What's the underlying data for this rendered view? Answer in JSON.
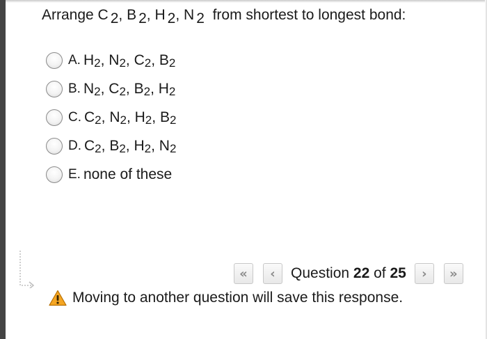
{
  "question": {
    "prefix": "Arrange ",
    "molecules": [
      {
        "el": "C",
        "sub": "2",
        "sep": ","
      },
      {
        "el": "B",
        "sub": "2",
        "sep": ","
      },
      {
        "el": "H",
        "sub": "2",
        "sep": ","
      },
      {
        "el": "N",
        "sub": "2",
        "sep": ""
      }
    ],
    "suffix": "from shortest to longest bond:"
  },
  "options": [
    {
      "letter": "A.",
      "molecules": [
        [
          "H",
          "2"
        ],
        [
          "N",
          "2"
        ],
        [
          "C",
          "2"
        ],
        [
          "B",
          "2"
        ]
      ]
    },
    {
      "letter": "B.",
      "molecules": [
        [
          "N",
          "2"
        ],
        [
          "C",
          "2"
        ],
        [
          "B",
          "2"
        ],
        [
          "H",
          "2"
        ]
      ]
    },
    {
      "letter": "C.",
      "molecules": [
        [
          "C",
          "2"
        ],
        [
          "N",
          "2"
        ],
        [
          "H",
          "2"
        ],
        [
          "B",
          "2"
        ]
      ]
    },
    {
      "letter": "D.",
      "molecules": [
        [
          "C",
          "2"
        ],
        [
          "B",
          "2"
        ],
        [
          "H",
          "2"
        ],
        [
          "N",
          "2"
        ]
      ]
    },
    {
      "letter": "E.",
      "text": "none of these"
    }
  ],
  "nav": {
    "first_glyph": "«",
    "prev_glyph": "‹",
    "next_glyph": "›",
    "last_glyph": "»",
    "counter_prefix": "Question",
    "current": "22",
    "counter_of": "of",
    "total": "25"
  },
  "warning": {
    "icon": "warning-icon",
    "text": "Moving to another question will save this response."
  },
  "colors": {
    "warning_fill": "#f5a623",
    "nav_glyph": "#8a8a8a"
  }
}
